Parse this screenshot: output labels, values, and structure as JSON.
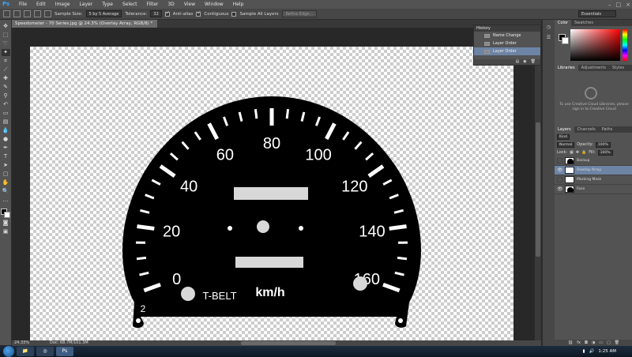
{
  "app": {
    "logo": "Ps"
  },
  "menu": [
    "File",
    "Edit",
    "Image",
    "Layer",
    "Type",
    "Select",
    "Filter",
    "3D",
    "View",
    "Window",
    "Help"
  ],
  "window_controls": [
    "–",
    "□",
    "×"
  ],
  "options": {
    "sample_size_label": "Sample Size:",
    "sample_size_value": "5 by 5 Average",
    "tolerance_label": "Tolerance:",
    "tolerance_value": "32",
    "antialias_label": "Anti-alias",
    "contiguous_label": "Contiguous",
    "sample_all_label": "Sample All Layers",
    "refine_edge_label": "Refine Edge...",
    "workspace": "Essentials"
  },
  "document": {
    "tab_title": "Speedometer - 70 Series.jpg @ 24.3% (Overlay Array, RGB/8) *",
    "zoom": "24.33%",
    "doc_info": "Doc: 68.7M/101.3M"
  },
  "gauge": {
    "speeds": [
      "0",
      "20",
      "40",
      "60",
      "80",
      "100",
      "120",
      "140",
      "160"
    ],
    "unit": "km/h",
    "belt": "T-BELT",
    "corner_number": "2"
  },
  "history": {
    "title": "History",
    "items": [
      "Name Change",
      "Layer Order",
      "Layer Order"
    ]
  },
  "color_panel": {
    "tabs": [
      "Color",
      "Swatches"
    ]
  },
  "libraries": {
    "tabs": [
      "Libraries",
      "Adjustments",
      "Styles"
    ],
    "message": "To use Creative Cloud Libraries, please sign in to Creative Cloud"
  },
  "layers": {
    "tabs": [
      "Layers",
      "Channels",
      "Paths"
    ],
    "kind": "Kind",
    "blend_mode": "Normal",
    "opacity_label": "Opacity:",
    "opacity": "100%",
    "lock_label": "Lock:",
    "fill_label": "Fill:",
    "fill": "100%",
    "items": [
      {
        "name": "Backup",
        "visible": false
      },
      {
        "name": "Overlay Array",
        "visible": true,
        "selected": true
      },
      {
        "name": "Marking Mask",
        "visible": false
      },
      {
        "name": "Face",
        "visible": true
      }
    ]
  },
  "taskbar": {
    "time": "1:25 AM"
  }
}
